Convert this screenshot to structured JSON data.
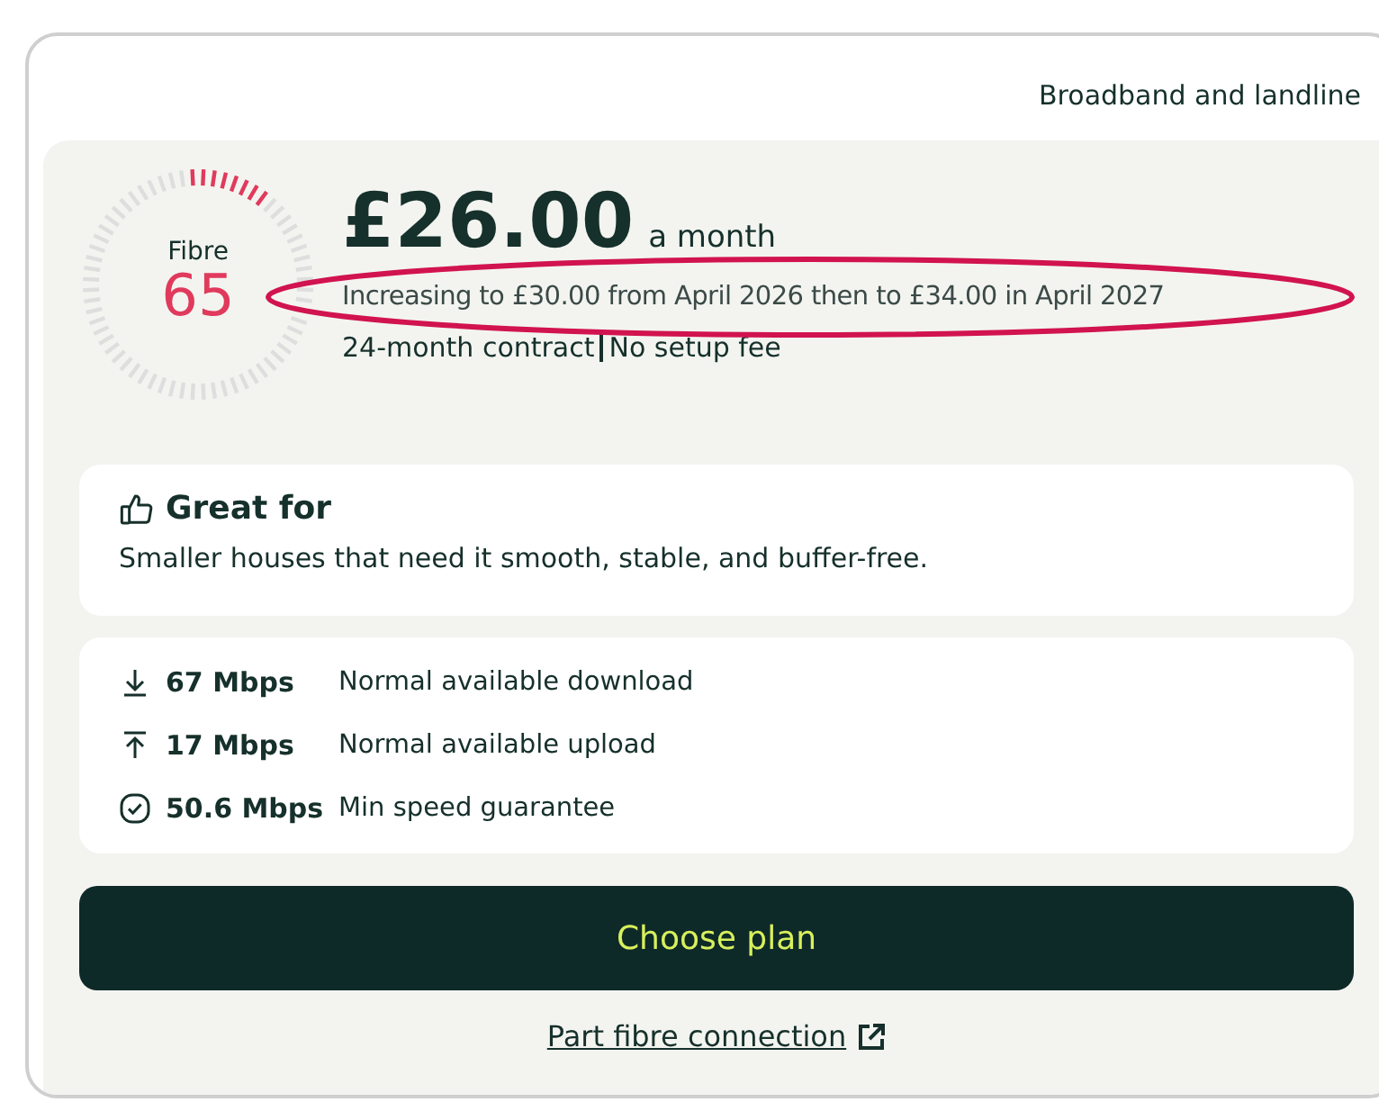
{
  "category": "Broadband and landline",
  "plan": {
    "badge_label": "Fibre",
    "badge_number": "65",
    "price": "£26.00",
    "price_period": "a month",
    "price_increase": "Increasing to £30.00 from April 2026 then to £34.00 in April 2027",
    "terms": "24-month contract",
    "terms_extra": "No setup fee"
  },
  "great_for": {
    "title": "Great for",
    "text": "Smaller houses that need it smooth, stable, and buffer-free."
  },
  "speeds": [
    {
      "kind": "download",
      "value": "67 Mbps",
      "label": "Normal available download"
    },
    {
      "kind": "upload",
      "value": "17 Mbps",
      "label": "Normal available upload"
    },
    {
      "kind": "guarantee",
      "value": "50.6 Mbps",
      "label": "Min speed guarantee"
    }
  ],
  "cta": "Choose plan",
  "link": "Part fibre connection"
}
